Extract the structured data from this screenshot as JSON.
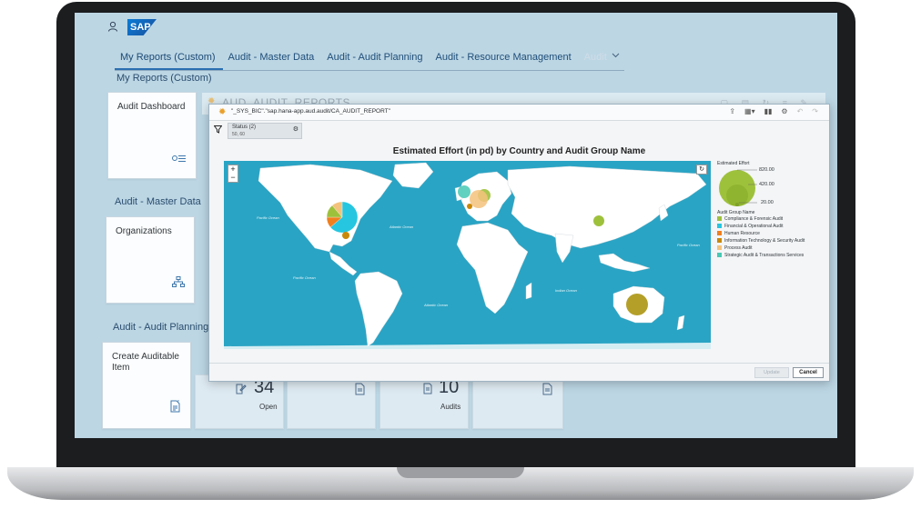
{
  "shell": {
    "logo": "SAP"
  },
  "tabs": [
    {
      "label": "My Reports (Custom)",
      "state": "active"
    },
    {
      "label": "Audit - Master Data",
      "state": "normal"
    },
    {
      "label": "Audit - Audit Planning",
      "state": "normal"
    },
    {
      "label": "Audit - Resource Management",
      "state": "normal"
    },
    {
      "label": "Audit",
      "state": "faded"
    }
  ],
  "sections": {
    "my_reports": "My Reports (Custom)",
    "master_data": "Audit - Master Data",
    "audit_planning": "Audit - Audit Planning"
  },
  "tiles": {
    "audit_dashboard": "Audit Dashboard",
    "organizations": "Organizations",
    "create_auditable_item": "Create Auditable Item",
    "open_count": "34",
    "open_label": "Open",
    "audits_count": "10",
    "audits_label": "Audits"
  },
  "background_window": {
    "title": "AUD_AUDIT_REPORTS"
  },
  "dialog": {
    "path": "\"_SYS_BIC\".\"sap.hana-app.aud.audit/CA_AUDIT_REPORT\"",
    "filter": {
      "label": "Status (2)",
      "value": "50, 60"
    },
    "buttons": {
      "update": "Update",
      "cancel": "Cancel"
    }
  },
  "chart_data": {
    "type": "bubble-pie-map",
    "title": "Estimated Effort (in pd) by Country and Audit Group Name",
    "size_legend": {
      "title": "Estimated Effort",
      "values": [
        820.0,
        420.0,
        20.0
      ]
    },
    "color_legend_title": "Audit Group Name",
    "groups": [
      {
        "name": "Compliance & Forensic Audit",
        "color": "#9ec13c"
      },
      {
        "name": "Financial & Operational Audit",
        "color": "#26c6e0"
      },
      {
        "name": "Human Resource",
        "color": "#f07f1e"
      },
      {
        "name": "Information Technology & Security Audit",
        "color": "#c8880a"
      },
      {
        "name": "Process Audit",
        "color": "#f4c27c"
      },
      {
        "name": "Strategic Audit & Transactions Services",
        "color": "#48c9b4"
      }
    ],
    "map_labels": [
      "Pacific Ocean",
      "Atlantic Ocean",
      "Pacific Ocean",
      "Atlantic Ocean",
      "Pacific Ocean",
      "Indian Ocean"
    ]
  }
}
